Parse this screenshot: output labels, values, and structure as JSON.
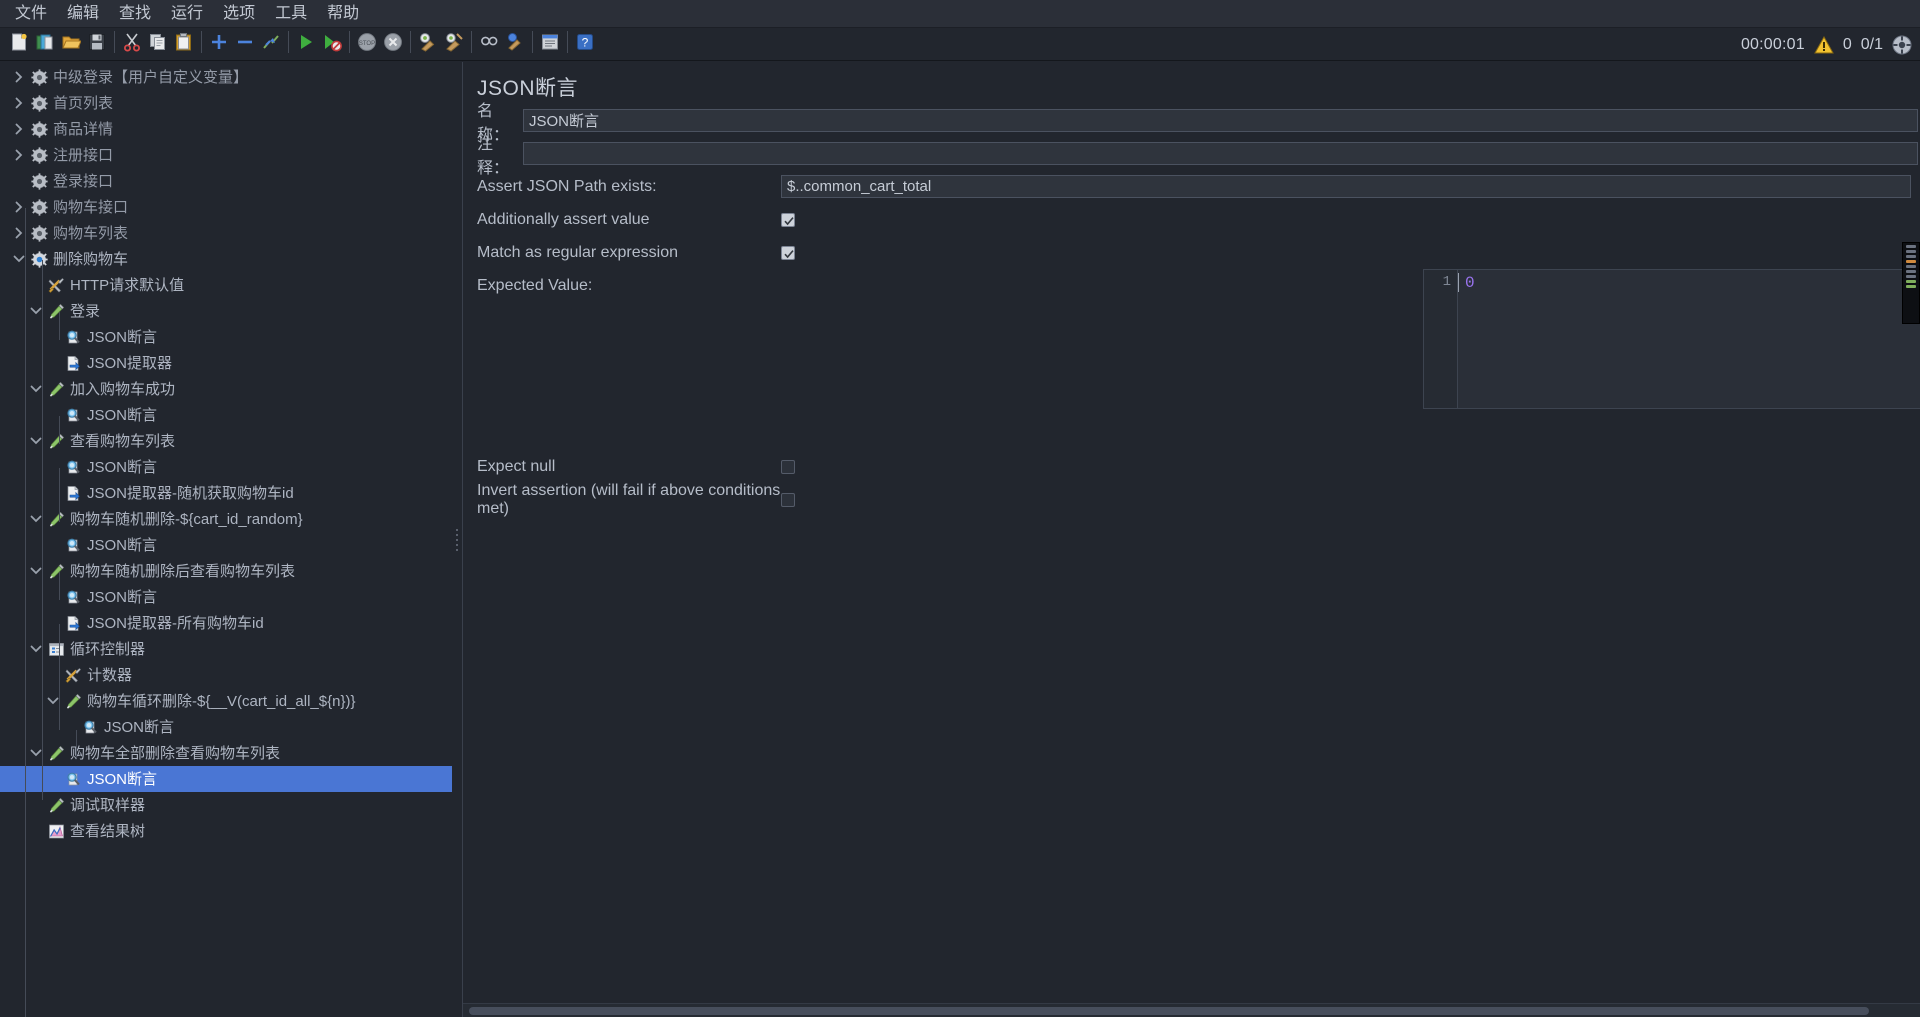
{
  "menubar": {
    "items": [
      {
        "label": "文件",
        "name": "menu-file"
      },
      {
        "label": "编辑",
        "name": "menu-edit"
      },
      {
        "label": "查找",
        "name": "menu-search"
      },
      {
        "label": "运行",
        "name": "menu-run"
      },
      {
        "label": "选项",
        "name": "menu-options"
      },
      {
        "label": "工具",
        "name": "menu-tools"
      },
      {
        "label": "帮助",
        "name": "menu-help"
      }
    ]
  },
  "toolbar": {
    "buttons": [
      {
        "icon": "new-document-icon",
        "name": "new-test-plan-button"
      },
      {
        "icon": "templates-icon",
        "name": "templates-button"
      },
      {
        "icon": "open-folder-icon",
        "name": "open-button"
      },
      {
        "icon": "save-disk-icon",
        "name": "save-button"
      },
      {
        "icon": "scissors-icon",
        "name": "cut-button"
      },
      {
        "icon": "copy-icon",
        "name": "copy-button"
      },
      {
        "icon": "paste-icon",
        "name": "paste-button"
      },
      {
        "icon": "plus-icon",
        "name": "expand-all-button"
      },
      {
        "icon": "minus-icon",
        "name": "collapse-all-button"
      },
      {
        "icon": "toggle-icon",
        "name": "toggle-button"
      },
      {
        "icon": "play-icon",
        "name": "start-button"
      },
      {
        "icon": "play-no-pause-icon",
        "name": "start-no-pauses-button"
      },
      {
        "icon": "stop-icon",
        "name": "stop-button"
      },
      {
        "icon": "shutdown-icon",
        "name": "shutdown-button"
      },
      {
        "icon": "clear-icon",
        "name": "clear-button"
      },
      {
        "icon": "clear-all-icon",
        "name": "clear-all-button"
      },
      {
        "icon": "search-toggle-icon",
        "name": "search-button"
      },
      {
        "icon": "reset-search-icon",
        "name": "reset-search-button"
      },
      {
        "icon": "function-helper-icon",
        "name": "function-helper-button"
      },
      {
        "icon": "help-icon",
        "name": "help-button"
      }
    ],
    "timer": "00:00:01",
    "warning_icon": "warning-triangle-icon",
    "warning_count": "0",
    "thread_counts": "0/1",
    "remote_icon": "remote-engine-icon"
  },
  "tree": {
    "nodes": [
      {
        "depth": 0,
        "toggle": "right",
        "icon": "gear-icon",
        "label": "中级登录【用户自定义变量】",
        "dim": true,
        "selected": false
      },
      {
        "depth": 0,
        "toggle": "right",
        "icon": "gear-icon",
        "label": "首页列表",
        "dim": true,
        "selected": false
      },
      {
        "depth": 0,
        "toggle": "right",
        "icon": "gear-icon",
        "label": "商品详情",
        "dim": true,
        "selected": false
      },
      {
        "depth": 0,
        "toggle": "right",
        "icon": "gear-icon",
        "label": "注册接口",
        "dim": true,
        "selected": false
      },
      {
        "depth": 0,
        "toggle": "none",
        "icon": "gear-icon",
        "label": "登录接口",
        "dim": true,
        "selected": false
      },
      {
        "depth": 0,
        "toggle": "right",
        "icon": "gear-icon",
        "label": "购物车接口",
        "dim": true,
        "selected": false
      },
      {
        "depth": 0,
        "toggle": "right",
        "icon": "gear-icon",
        "label": "购物车列表",
        "dim": true,
        "selected": false
      },
      {
        "depth": 0,
        "toggle": "down",
        "icon": "gear-active-icon",
        "label": "删除购物车",
        "dim": false,
        "selected": false
      },
      {
        "depth": 1,
        "toggle": "none",
        "icon": "config-tools-icon",
        "label": "HTTP请求默认值",
        "dim": false,
        "selected": false
      },
      {
        "depth": 1,
        "toggle": "down",
        "icon": "sampler-pen-icon",
        "label": "登录",
        "dim": false,
        "selected": false
      },
      {
        "depth": 2,
        "toggle": "none",
        "icon": "assertion-magnifier-icon",
        "label": "JSON断言",
        "dim": false,
        "selected": false
      },
      {
        "depth": 2,
        "toggle": "none",
        "icon": "extractor-doc-icon",
        "label": "JSON提取器",
        "dim": false,
        "selected": false
      },
      {
        "depth": 1,
        "toggle": "down",
        "icon": "sampler-pen-icon",
        "label": "加入购物车成功",
        "dim": false,
        "selected": false
      },
      {
        "depth": 2,
        "toggle": "none",
        "icon": "assertion-magnifier-icon",
        "label": "JSON断言",
        "dim": false,
        "selected": false
      },
      {
        "depth": 1,
        "toggle": "down",
        "icon": "sampler-pen-icon",
        "label": "查看购物车列表",
        "dim": false,
        "selected": false
      },
      {
        "depth": 2,
        "toggle": "none",
        "icon": "assertion-magnifier-icon",
        "label": "JSON断言",
        "dim": false,
        "selected": false
      },
      {
        "depth": 2,
        "toggle": "none",
        "icon": "extractor-doc-icon",
        "label": "JSON提取器-随机获取购物车id",
        "dim": false,
        "selected": false
      },
      {
        "depth": 1,
        "toggle": "down",
        "icon": "sampler-pen-icon",
        "label": "购物车随机删除-${cart_id_random}",
        "dim": false,
        "selected": false
      },
      {
        "depth": 2,
        "toggle": "none",
        "icon": "assertion-magnifier-icon",
        "label": "JSON断言",
        "dim": false,
        "selected": false
      },
      {
        "depth": 1,
        "toggle": "down",
        "icon": "sampler-pen-icon",
        "label": "购物车随机删除后查看购物车列表",
        "dim": false,
        "selected": false
      },
      {
        "depth": 2,
        "toggle": "none",
        "icon": "assertion-magnifier-icon",
        "label": "JSON断言",
        "dim": false,
        "selected": false
      },
      {
        "depth": 2,
        "toggle": "none",
        "icon": "extractor-doc-icon",
        "label": "JSON提取器-所有购物车id",
        "dim": false,
        "selected": false
      },
      {
        "depth": 1,
        "toggle": "down",
        "icon": "loop-controller-icon",
        "label": "循环控制器",
        "dim": false,
        "selected": false
      },
      {
        "depth": 2,
        "toggle": "none",
        "icon": "config-tools-icon",
        "label": "计数器",
        "dim": false,
        "selected": false
      },
      {
        "depth": 2,
        "toggle": "down",
        "icon": "sampler-pen-icon",
        "label": "购物车循环删除-${__V(cart_id_all_${n})}",
        "dim": false,
        "selected": false
      },
      {
        "depth": 3,
        "toggle": "none",
        "icon": "assertion-magnifier-icon",
        "label": "JSON断言",
        "dim": false,
        "selected": false
      },
      {
        "depth": 1,
        "toggle": "down",
        "icon": "sampler-pen-icon",
        "label": "购物车全部删除查看购物车列表",
        "dim": false,
        "selected": false
      },
      {
        "depth": 2,
        "toggle": "none",
        "icon": "assertion-magnifier-icon",
        "label": "JSON断言",
        "dim": false,
        "selected": true
      },
      {
        "depth": 1,
        "toggle": "none",
        "icon": "sampler-pen-icon",
        "label": "调试取样器",
        "dim": false,
        "selected": false
      },
      {
        "depth": 1,
        "toggle": "none",
        "icon": "results-tree-icon",
        "label": "查看结果树",
        "dim": false,
        "selected": false
      }
    ]
  },
  "detail": {
    "title": "JSON断言",
    "name_label": "名称：",
    "name_value": "JSON断言",
    "comment_label": "注释：",
    "comment_value": "",
    "assert_path_label": "Assert JSON Path exists:",
    "assert_path_value": "$..common_cart_total",
    "additionally_assert_label": "Additionally assert value",
    "additionally_assert_checked": true,
    "match_regex_label": "Match as regular expression",
    "match_regex_checked": true,
    "expected_value_label": "Expected Value:",
    "expected_value_line_number": "1",
    "expected_value_text": "0",
    "expect_null_label": "Expect null",
    "expect_null_checked": false,
    "invert_assertion_label": "Invert assertion (will fail if above conditions met)",
    "invert_assertion_checked": false
  },
  "colors": {
    "selection": "#4a76d4",
    "window_bg": "#22262e",
    "menu_bg": "#2b2f38",
    "text": "#b9c0cc",
    "code_value": "#9a74f0"
  }
}
